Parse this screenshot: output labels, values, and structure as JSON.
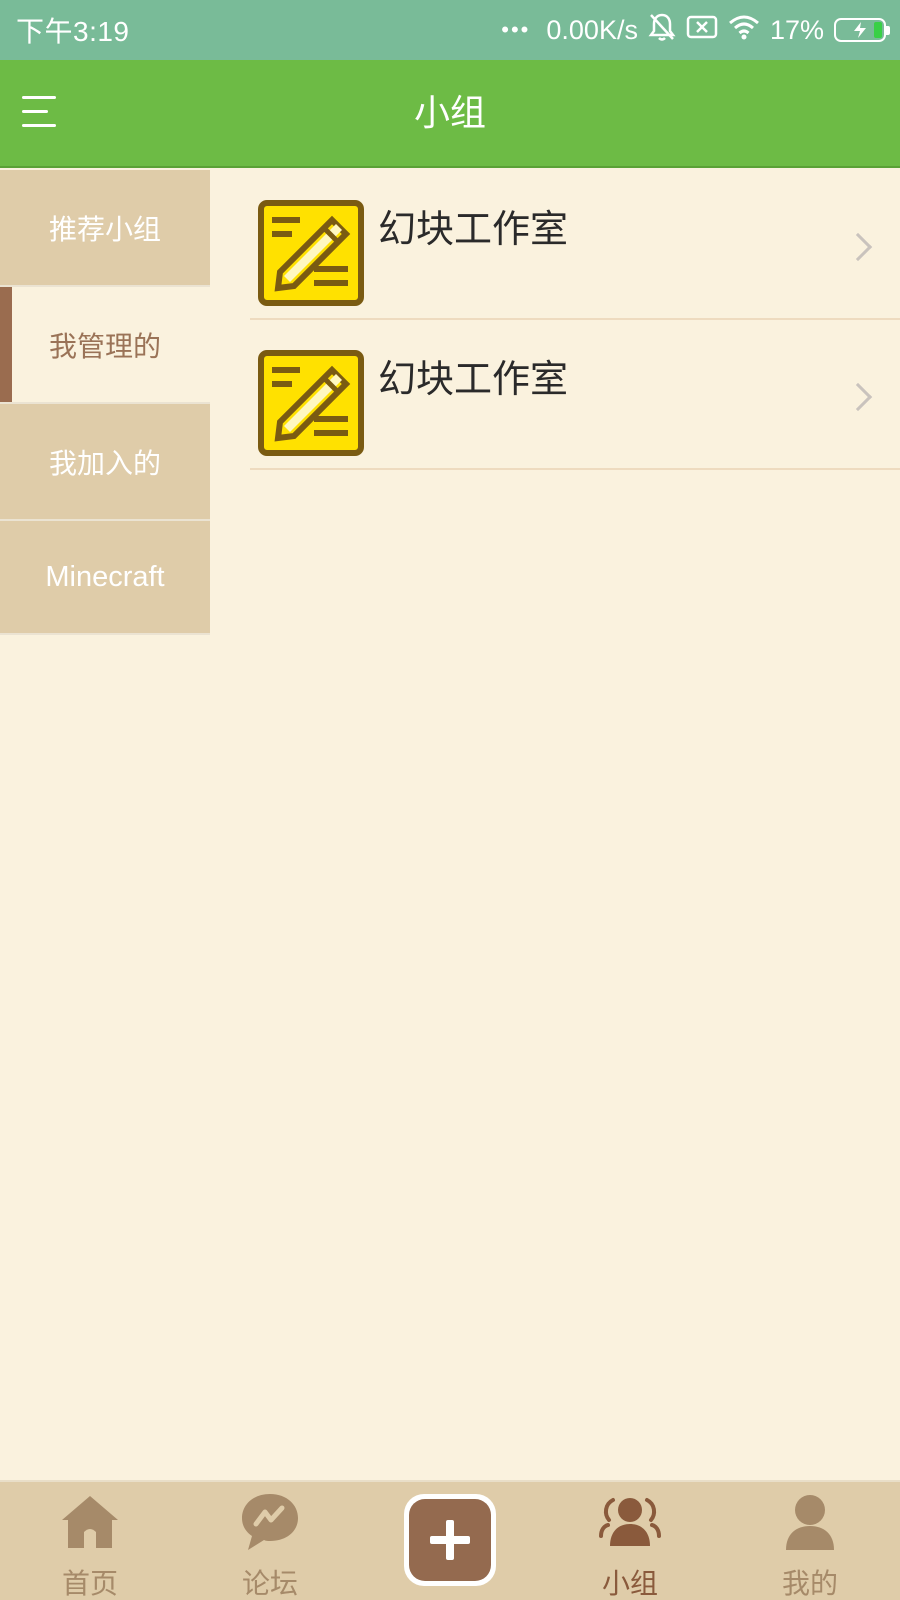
{
  "status_bar": {
    "time": "下午3:19",
    "dots": "•••",
    "net_speed": "0.00K/s",
    "battery": "17%",
    "battery_level": 0.17,
    "icons": [
      "notifications-off-icon",
      "sim-off-icon",
      "wifi-icon",
      "battery-charging-icon"
    ]
  },
  "app_bar": {
    "title": "小组",
    "menu_icon": "menu-icon"
  },
  "side_nav": {
    "items": [
      {
        "label": "推荐小组",
        "active": false
      },
      {
        "label": "我管理的",
        "active": true
      },
      {
        "label": "我加入的",
        "active": false
      },
      {
        "label": "Minecraft",
        "active": false
      }
    ]
  },
  "groups": [
    {
      "name": "幻块工作室",
      "icon": "pencil-note-icon"
    },
    {
      "name": "幻块工作室",
      "icon": "pencil-note-icon"
    }
  ],
  "bottom_nav": {
    "tabs": [
      {
        "label": "首页",
        "icon": "home-icon"
      },
      {
        "label": "论坛",
        "icon": "forum-icon"
      },
      {
        "label": "",
        "icon": "add-icon"
      },
      {
        "label": "小组",
        "icon": "group-icon",
        "active": true
      },
      {
        "label": "我的",
        "icon": "profile-icon"
      }
    ]
  },
  "colors": {
    "status_bar": "#79bb98",
    "app_bar": "#6dbb45",
    "background": "#faf2de",
    "side_nav": "#dfcca9",
    "active_accent": "#9a6c4f",
    "bottom_nav": "#dfcca9"
  }
}
